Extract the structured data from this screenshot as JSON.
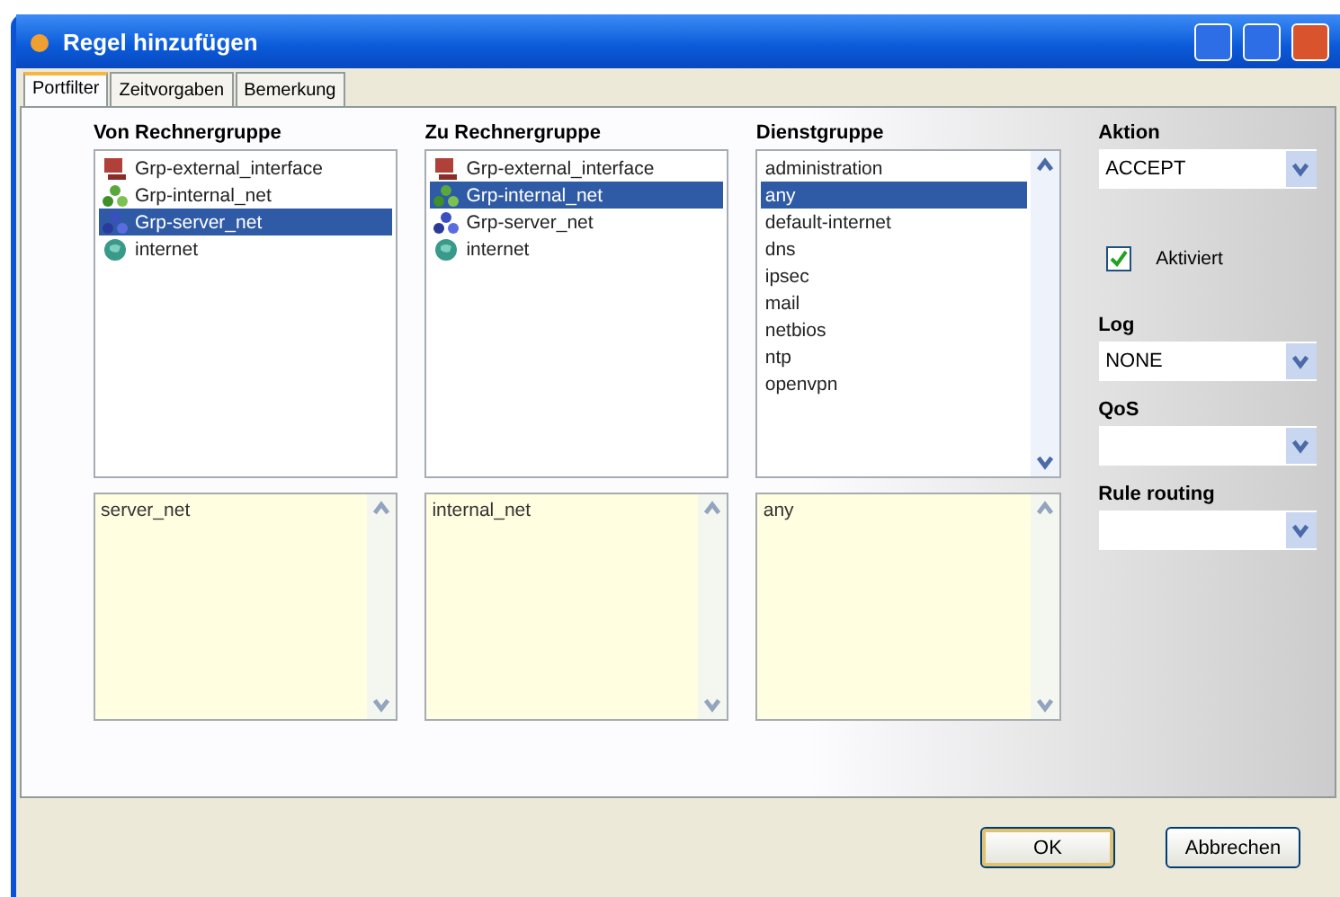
{
  "window": {
    "title": "Regel hinzufügen"
  },
  "tabs": [
    {
      "label": "Portfilter",
      "selected": true
    },
    {
      "label": "Zeitvorgaben",
      "selected": false
    },
    {
      "label": "Bemerkung",
      "selected": false
    }
  ],
  "groups": [
    {
      "title": "Von Rechnergruppe",
      "items": [
        {
          "label": "Grp-external_interface",
          "kind": "host",
          "selected": false
        },
        {
          "label": "Grp-internal_net",
          "kind": "lan",
          "selected": false
        },
        {
          "label": "Grp-server_net",
          "kind": "server",
          "selected": true
        },
        {
          "label": "internet",
          "kind": "globe",
          "selected": false
        }
      ],
      "note": "server_net"
    },
    {
      "title": "Zu Rechnergruppe",
      "items": [
        {
          "label": "Grp-external_interface",
          "kind": "host",
          "selected": false
        },
        {
          "label": "Grp-internal_net",
          "kind": "lan",
          "selected": true
        },
        {
          "label": "Grp-server_net",
          "kind": "server",
          "selected": false
        },
        {
          "label": "internet",
          "kind": "globe",
          "selected": false
        }
      ],
      "note": "internal_net"
    },
    {
      "title": "Dienstgruppe",
      "items": [
        {
          "label": "administration",
          "kind": "text",
          "selected": false
        },
        {
          "label": "any",
          "kind": "text",
          "selected": true
        },
        {
          "label": "default-internet",
          "kind": "text",
          "selected": false
        },
        {
          "label": "dns",
          "kind": "text",
          "selected": false
        },
        {
          "label": "ipsec",
          "kind": "text",
          "selected": false
        },
        {
          "label": "mail",
          "kind": "text",
          "selected": false
        },
        {
          "label": "netbios",
          "kind": "text",
          "selected": false
        },
        {
          "label": "ntp",
          "kind": "text",
          "selected": false
        },
        {
          "label": "openvpn",
          "kind": "text",
          "selected": false
        }
      ],
      "note": "any"
    }
  ],
  "aktion": {
    "label": "Aktion",
    "value": "ACCEPT"
  },
  "aktiviert": {
    "label": "Aktiviert",
    "checked": true
  },
  "log": {
    "label": "Log",
    "value": "NONE"
  },
  "qos": {
    "label": "QoS"
  },
  "rule_routing": {
    "label": "Rule routing"
  },
  "buttons": [
    {
      "label": "OK",
      "kind": "default"
    },
    {
      "label": "Abbrechen",
      "kind": "normal"
    }
  ]
}
